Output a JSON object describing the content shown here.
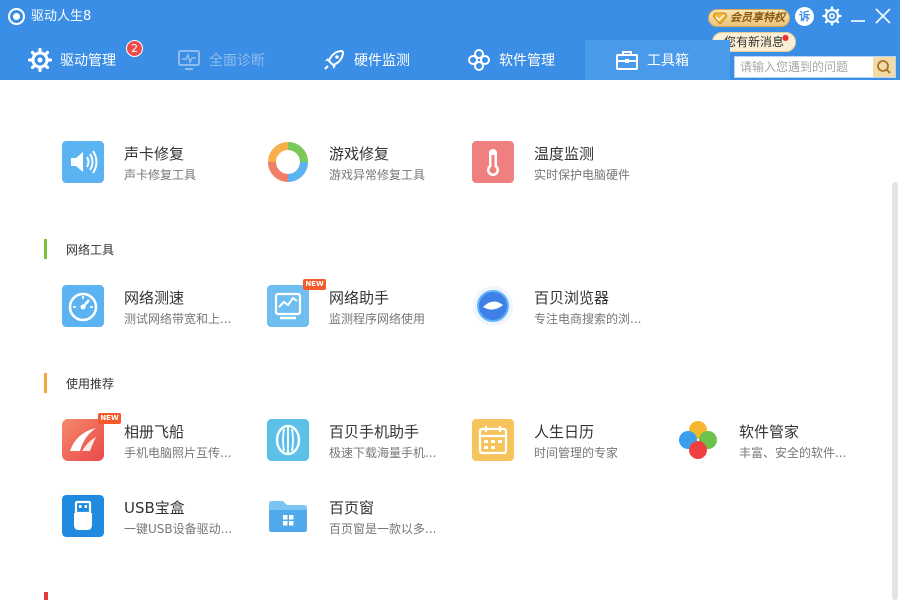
{
  "app": {
    "title": "驱动人生8"
  },
  "header": {
    "vip_label": "会员享特权",
    "notice": "您有新消息",
    "notice_dot": "●",
    "avatar_text": "诉"
  },
  "nav": {
    "tabs": [
      {
        "label": "驱动管理",
        "badge": "2",
        "state": "normal"
      },
      {
        "label": "全面诊断",
        "state": "disabled"
      },
      {
        "label": "硬件监测",
        "state": "normal"
      },
      {
        "label": "软件管理",
        "state": "normal"
      },
      {
        "label": "工具箱",
        "state": "active"
      }
    ]
  },
  "search": {
    "placeholder": "请输入您遇到的问题",
    "value": ""
  },
  "sections": {
    "top": {
      "tools": [
        {
          "name": "声卡修复",
          "desc": "声卡修复工具",
          "icon": "speaker-icon"
        },
        {
          "name": "游戏修复",
          "desc": "游戏异常修复工具",
          "icon": "ring-icon"
        },
        {
          "name": "温度监测",
          "desc": "实时保护电脑硬件",
          "icon": "thermometer-icon"
        }
      ]
    },
    "network": {
      "title": "网络工具",
      "tools": [
        {
          "name": "网络测速",
          "desc": "测试网络带宽和上...",
          "icon": "gauge-icon"
        },
        {
          "name": "网络助手",
          "desc": "监测程序网络使用",
          "icon": "monitor-chart-icon",
          "tag": "NEW"
        },
        {
          "name": "百贝浏览器",
          "desc": "专注电商搜索的浏...",
          "icon": "browser-icon"
        }
      ]
    },
    "recommend": {
      "title": "使用推荐",
      "tools": [
        {
          "name": "相册飞船",
          "desc": "手机电脑照片互传...",
          "icon": "album-icon",
          "tag": "NEW"
        },
        {
          "name": "百贝手机助手",
          "desc": "极速下载海量手机...",
          "icon": "phone-assistant-icon"
        },
        {
          "name": "人生日历",
          "desc": "时间管理的专家",
          "icon": "calendar-icon"
        },
        {
          "name": "软件管家",
          "desc": "丰富、安全的软件...",
          "icon": "clover-icon"
        },
        {
          "name": "USB宝盒",
          "desc": "一键USB设备驱动...",
          "icon": "usb-icon"
        },
        {
          "name": "百页窗",
          "desc": "百页窗是一款以多...",
          "icon": "folder-icon"
        }
      ]
    }
  },
  "colors": {
    "header_bg": "#3b8ee6",
    "network_accent": "#7cc242",
    "recommend_accent": "#f2a63a",
    "new_tag": "#f55a2a"
  }
}
